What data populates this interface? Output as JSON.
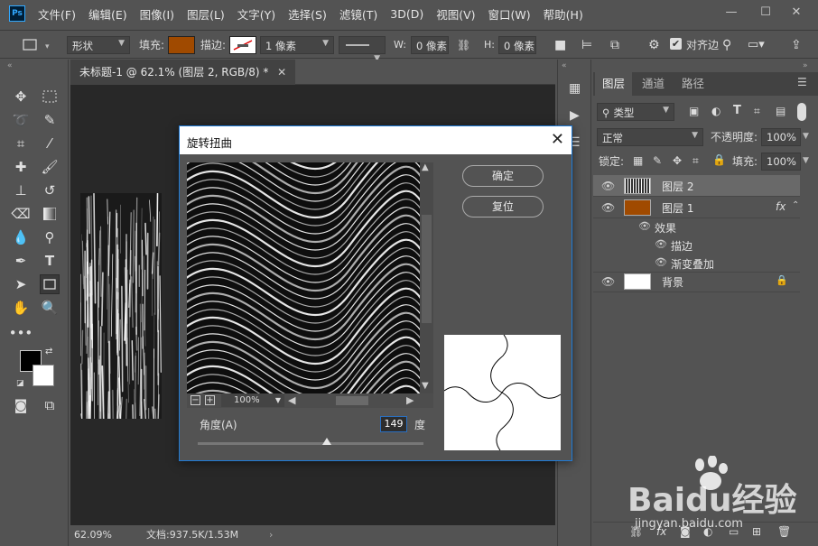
{
  "app": {
    "logo_text": "Ps",
    "menu": [
      "文件(F)",
      "编辑(E)",
      "图像(I)",
      "图层(L)",
      "文字(Y)",
      "选择(S)",
      "滤镜(T)",
      "3D(D)",
      "视图(V)",
      "窗口(W)",
      "帮助(H)"
    ]
  },
  "options_bar": {
    "mode": "形状",
    "fill_label": "填充:",
    "fill_color": "#a04a00",
    "stroke_label": "描边:",
    "stroke_width": "1 像素",
    "w_label": "W:",
    "w_value": "0 像素",
    "h_label": "H:",
    "h_value": "0 像素",
    "align_edges": "对齐边"
  },
  "document": {
    "tab_title": "未标题-1 @ 62.1% (图层 2, RGB/8) *",
    "zoom": "62.09%",
    "doc_info": "文档:937.5K/1.53M"
  },
  "dialog": {
    "title": "旋转扭曲",
    "ok_label": "确定",
    "reset_label": "复位",
    "zoom_level": "100%",
    "angle_label": "角度(A)",
    "angle_value": "149",
    "angle_unit": "度",
    "angle_slider_fraction": 0.57
  },
  "layers_panel": {
    "tabs": [
      "图层",
      "通道",
      "路径"
    ],
    "filter_kind": "类型",
    "blend_mode": "正常",
    "opacity_label": "不透明度:",
    "opacity_value": "100%",
    "lock_label": "锁定:",
    "fill_label": "填充:",
    "fill_value": "100%",
    "layers": [
      {
        "name": "图层 2",
        "active": true
      },
      {
        "name": "图层 1",
        "fx": "fx"
      },
      {
        "name": "效果"
      },
      {
        "name": "描边"
      },
      {
        "name": "渐变叠加"
      },
      {
        "name": "背景"
      }
    ]
  },
  "watermark": {
    "brand": "Baidu经验",
    "url": "jingyan.baidu.com"
  }
}
